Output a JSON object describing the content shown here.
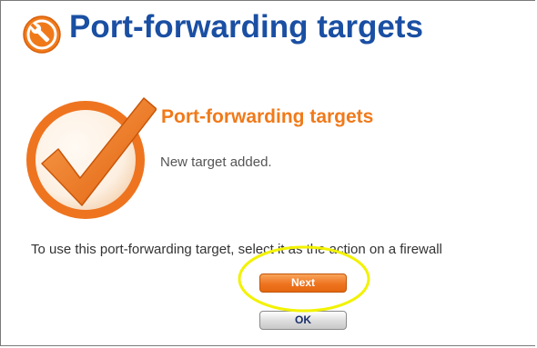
{
  "header": {
    "title": "Port-forwarding targets",
    "icon": "wrench-icon"
  },
  "result": {
    "icon": "checkmark-icon",
    "heading": "Port-forwarding targets",
    "message": "New target added."
  },
  "instructions": {
    "text": "To use this port-forwarding target, select it as the action on a firewall"
  },
  "buttons": {
    "next_label": "Next",
    "ok_label": "OK"
  },
  "colors": {
    "title": "#1a4fa3",
    "accent_orange": "#f07a1a",
    "highlight": "#f2f200"
  }
}
